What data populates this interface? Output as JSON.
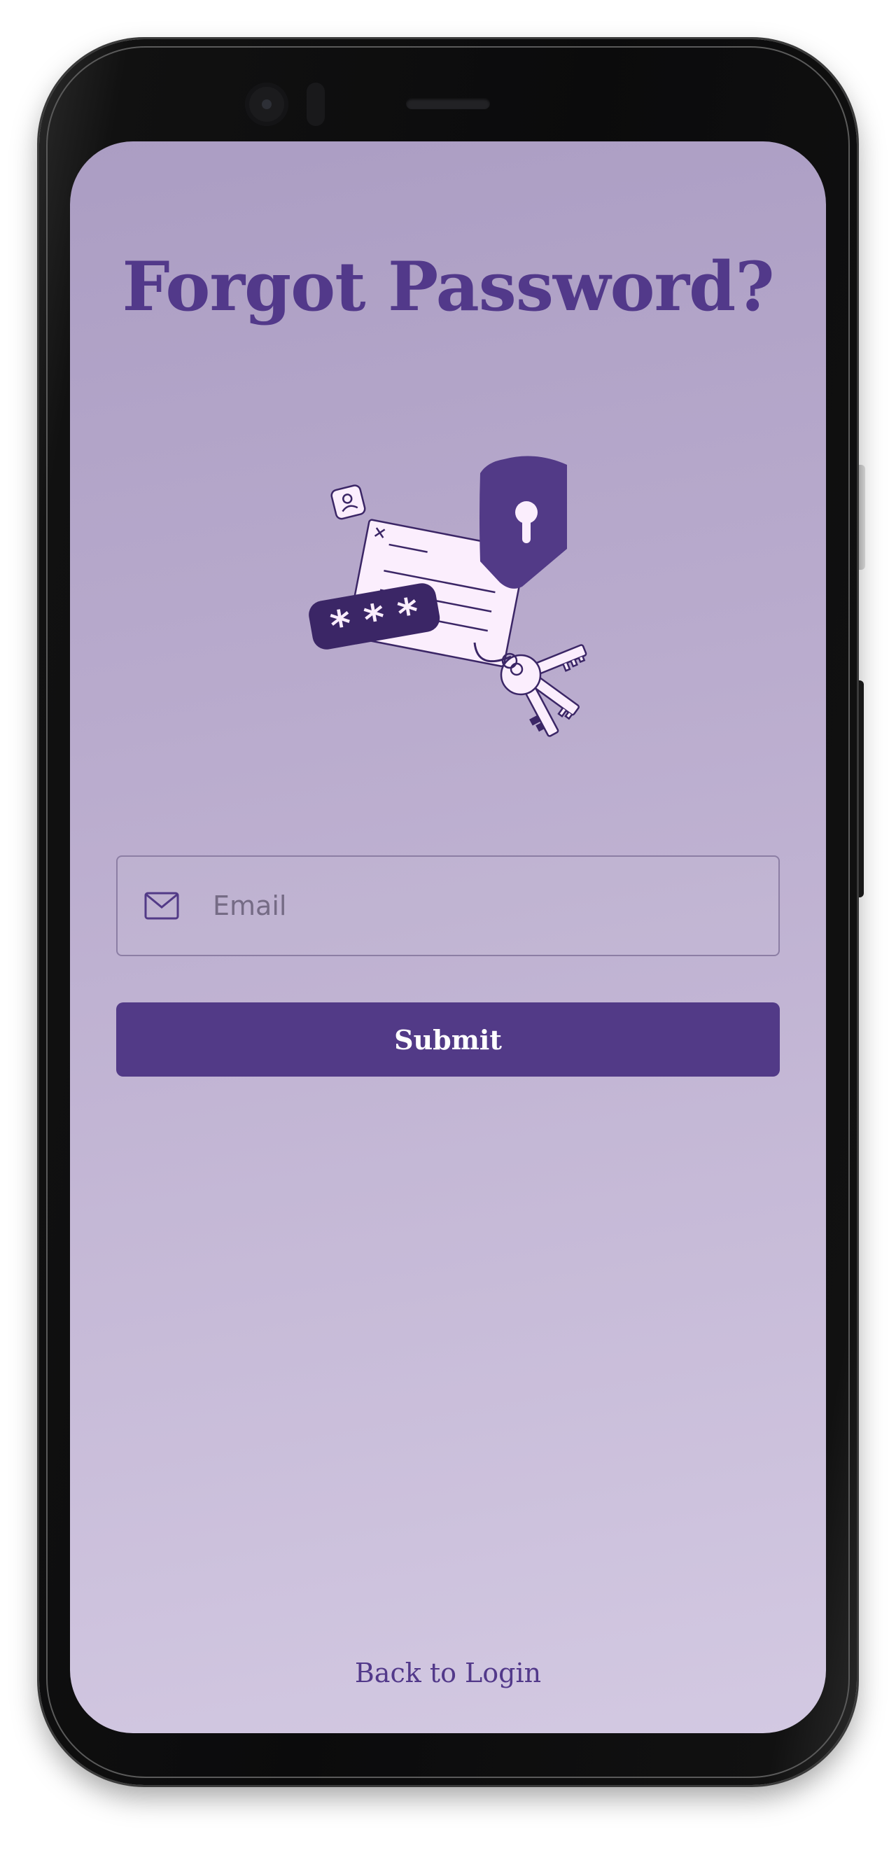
{
  "screen": {
    "title": "Forgot Password?",
    "email_placeholder": "Email",
    "email_value": "",
    "submit_label": "Submit",
    "back_link_label": "Back to Login"
  },
  "illustration": {
    "password_mask": "* * *",
    "icons": [
      "user-badge-icon",
      "document-icon",
      "password-pill-icon",
      "shield-lock-icon",
      "keys-icon"
    ]
  },
  "icons": {
    "email": "envelope-icon"
  },
  "colors": {
    "primary": "#523a87",
    "title": "#52398a",
    "background_top": "#ab9dc3",
    "background_bottom": "#d3c9e2",
    "paper": "#fbeefd",
    "button_text": "#ffffff"
  }
}
